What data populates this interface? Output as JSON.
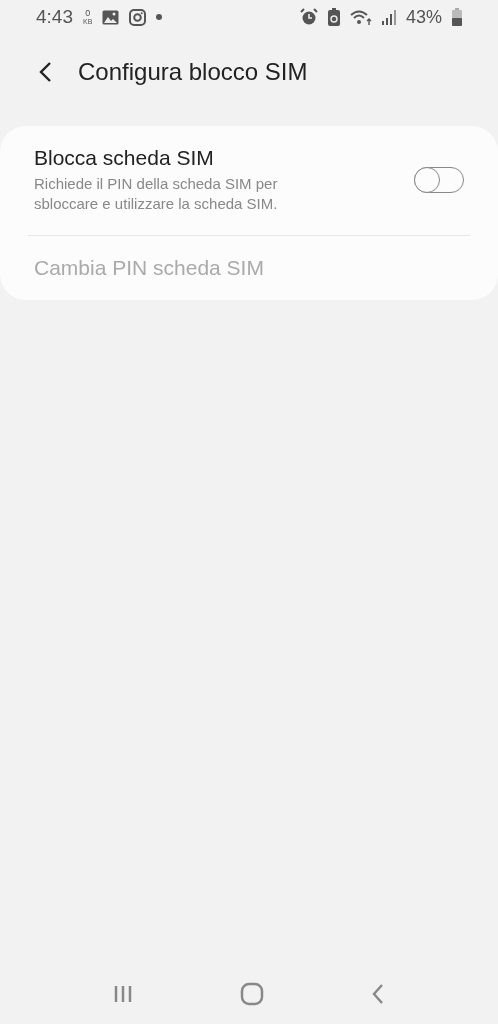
{
  "status_bar": {
    "time": "4:43",
    "speed_value": "0",
    "speed_unit": "KB",
    "battery": "43%"
  },
  "header": {
    "title": "Configura blocco SIM"
  },
  "settings": [
    {
      "kind": "toggle",
      "title": "Blocca scheda SIM",
      "summary": "Richiede il PIN della scheda SIM per sbloccare e utilizzare la scheda SIM.",
      "on": false,
      "disabled": false
    },
    {
      "kind": "link",
      "title": "Cambia PIN scheda SIM",
      "disabled": true
    }
  ]
}
